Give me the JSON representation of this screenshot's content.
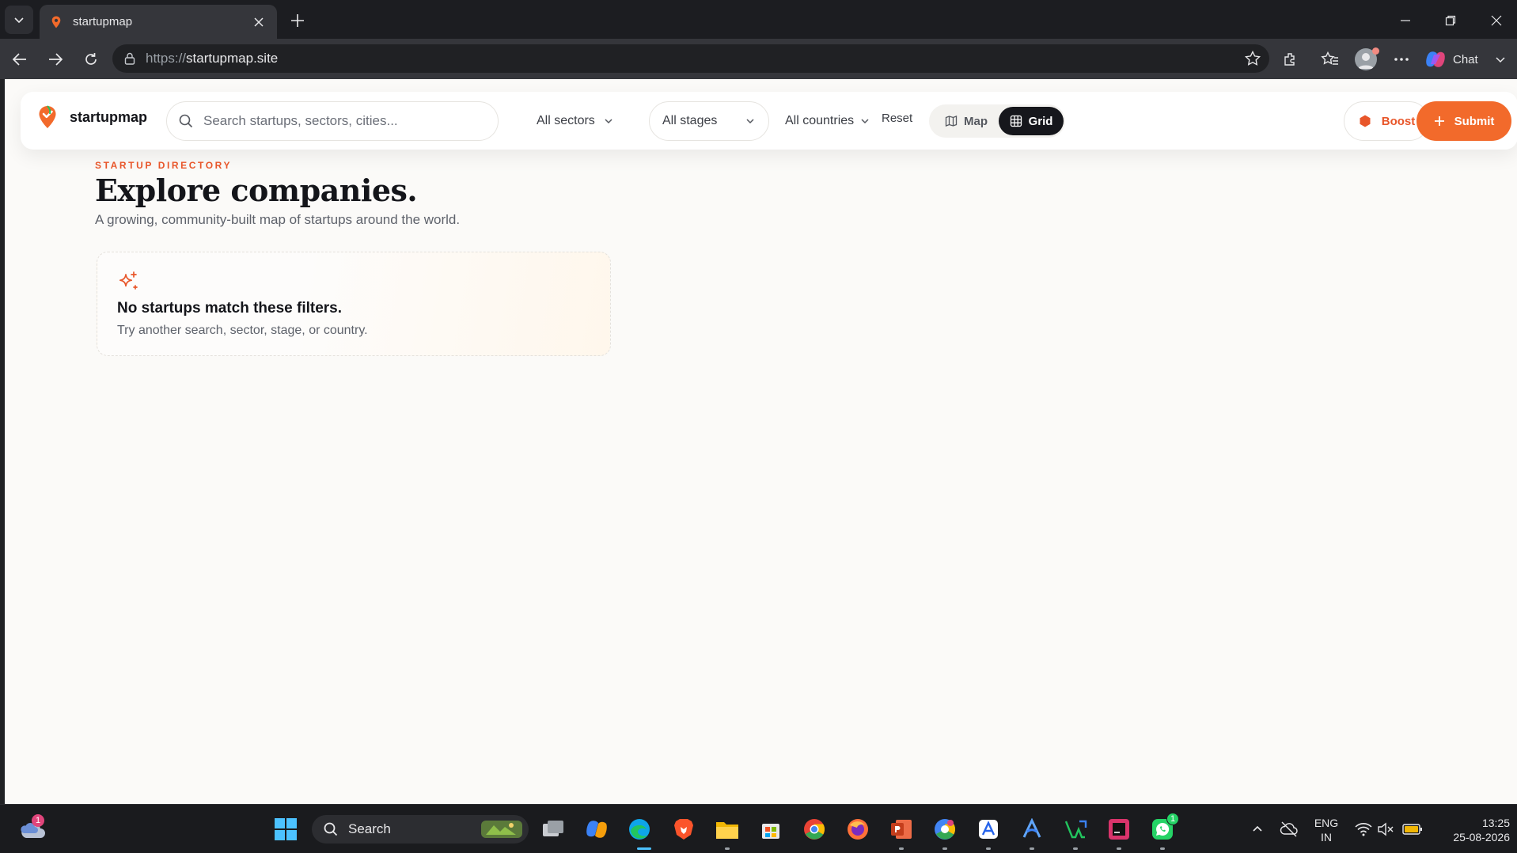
{
  "browser": {
    "tab_title": "startupmap",
    "url_protocol": "https://",
    "url_host": "startupmap.site",
    "chat_label": "Chat"
  },
  "header": {
    "logo_text": "startupmap",
    "search_placeholder": "Search startups, sectors, cities...",
    "sector_select": "All sectors",
    "stage_select": "All stages",
    "country_select": "All countries",
    "reset_label": "Reset",
    "view_map_label": "Map",
    "view_grid_label": "Grid",
    "active_view": "grid",
    "boost_label": "Boost",
    "submit_label": "Submit"
  },
  "main": {
    "eyebrow": "STARTUP DIRECTORY",
    "title": "Explore companies.",
    "subtitle": "A growing, community-built map of startups around the world.",
    "empty_title": "No startups match these filters.",
    "empty_text": "Try another search, sector, stage, or country."
  },
  "taskbar": {
    "search_label": "Search",
    "weather_badge": "1",
    "whatsapp_badge": "1",
    "lang_line1": "ENG",
    "lang_line2": "IN",
    "time": "13:25",
    "date": "25-08-2026"
  },
  "colors": {
    "accent": "#f26a2b",
    "accent_text": "#e8562a",
    "page_bg": "#fbfaf8",
    "dark": "#16171c"
  }
}
